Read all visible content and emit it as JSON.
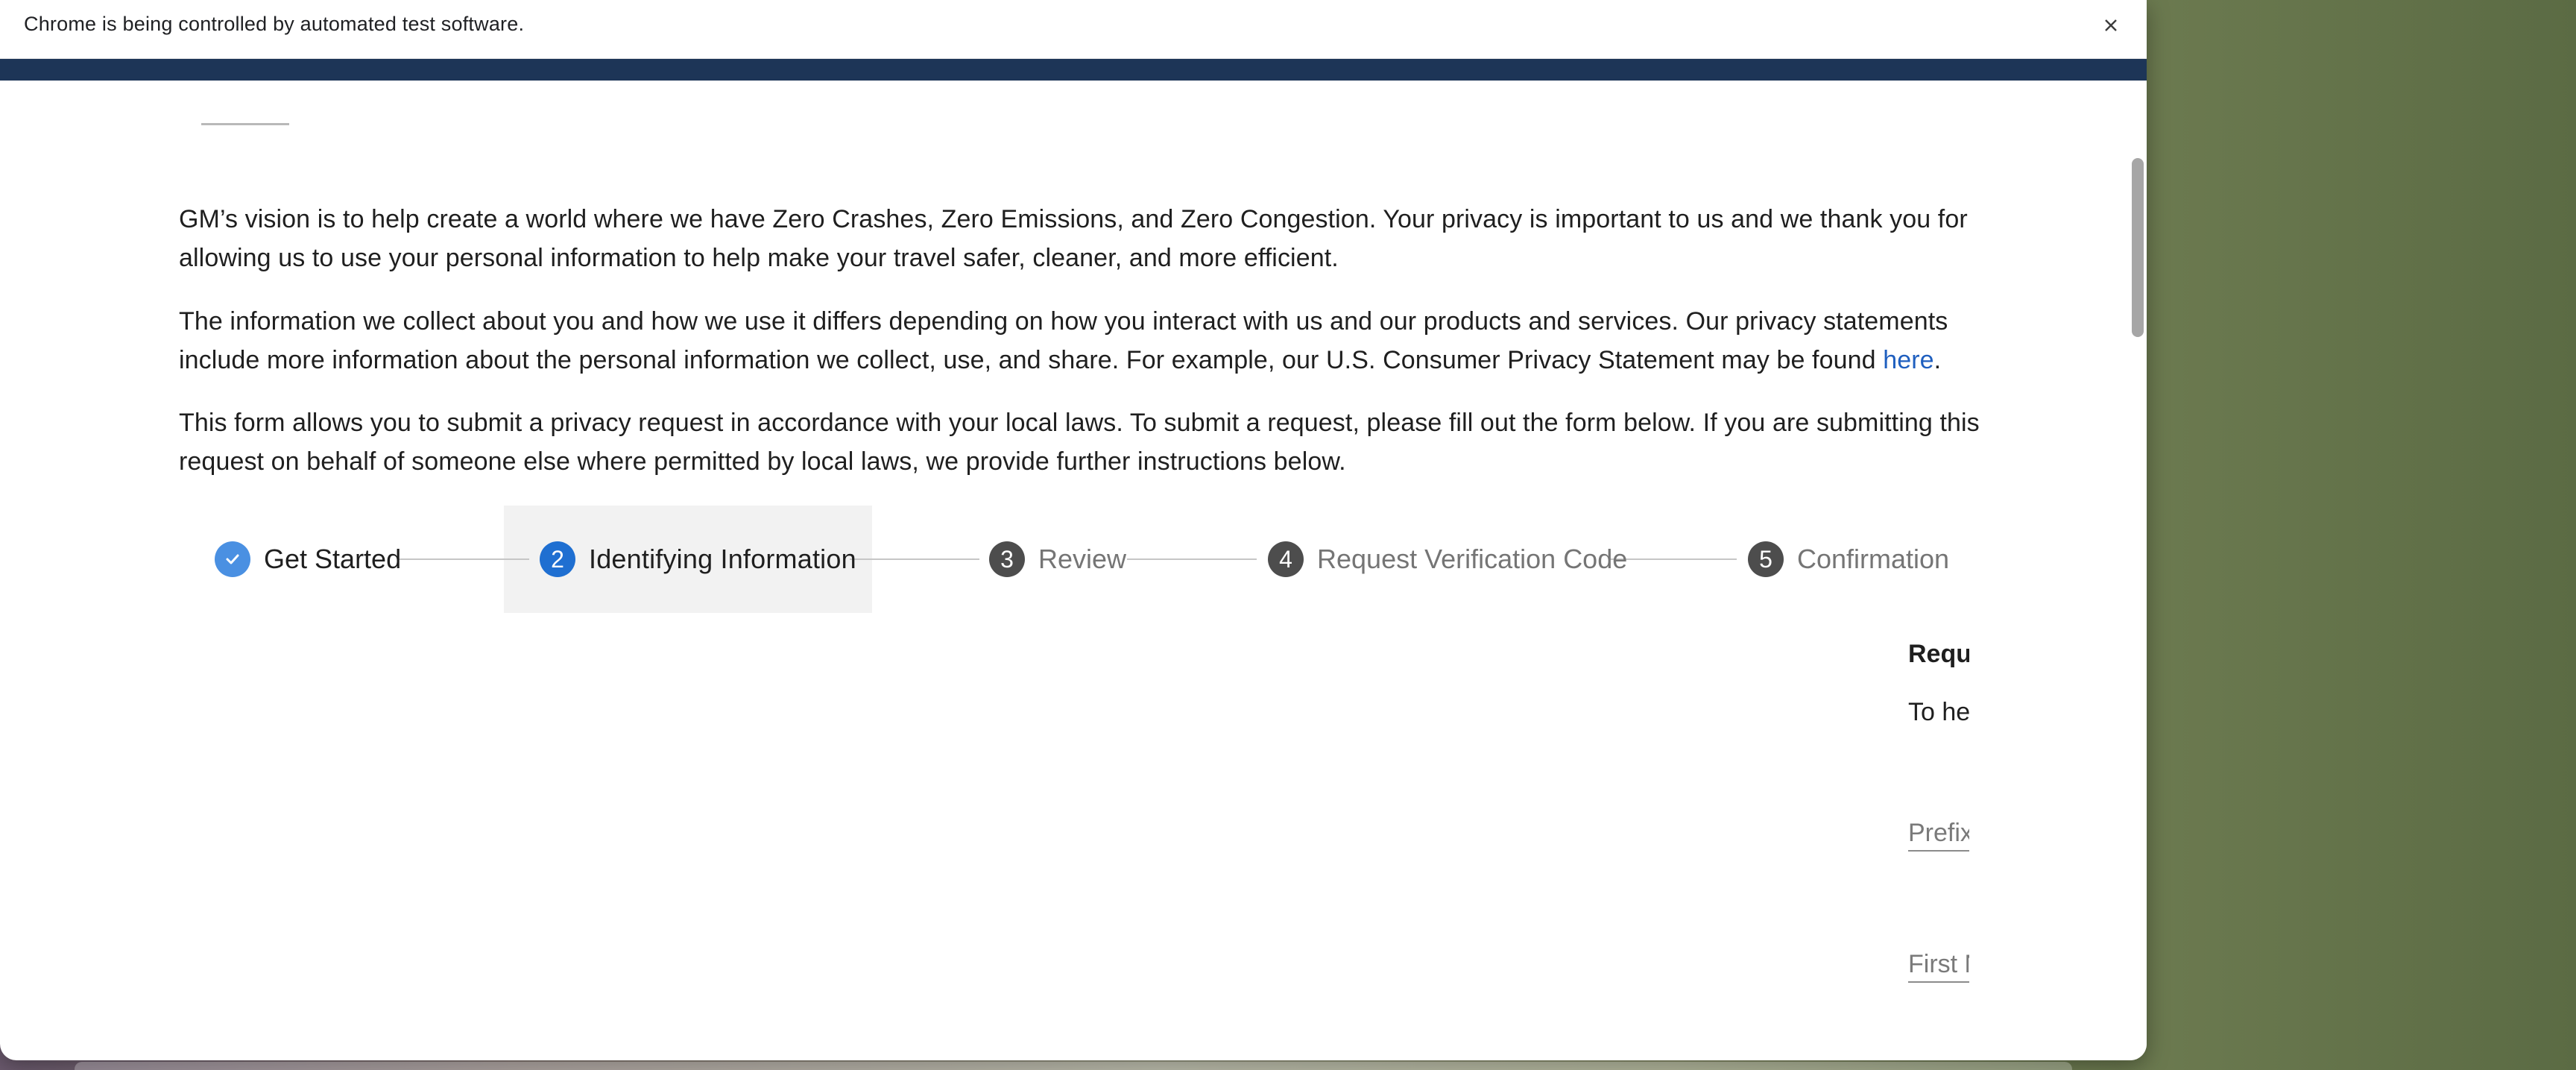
{
  "infobar": {
    "message": "Chrome is being controlled by automated test software.",
    "close_icon": "close-icon"
  },
  "intro": {
    "paragraph1": "GM’s vision is to help create a world where we have Zero Crashes, Zero Emissions, and Zero Congestion. Your privacy is important to us and we thank you for allowing us to use your personal information to help make your travel safer, cleaner, and more efficient.",
    "paragraph2_text": "The information we collect about you and how we use it differs depending on how you interact with us and our products and services. Our privacy statements include more information about the personal information we collect, use, and share. For example, our U.S. Consumer Privacy Statement may be found ",
    "paragraph2_link": "here",
    "paragraph2_end": ".",
    "paragraph3": "This form allows you to submit a privacy request in accordance with your local laws. To submit a request, please fill out the form below. If you are submitting this request on behalf of someone else where permitted by local laws, we provide further instructions below."
  },
  "stepper": {
    "steps": [
      {
        "number": "",
        "label": "Get Started",
        "state": "done",
        "icon": "check-icon"
      },
      {
        "number": "2",
        "label": "Identifying Information",
        "state": "active"
      },
      {
        "number": "3",
        "label": "Review",
        "state": "todo"
      },
      {
        "number": "4",
        "label": "Request Verification Code",
        "state": "todo"
      },
      {
        "number": "5",
        "label": "Confirmation",
        "state": "todo"
      }
    ]
  },
  "form": {
    "heading_partial": "Reque",
    "text_partial": "To hel",
    "prefix_placeholder": "Prefix",
    "first_name_placeholder": "First N"
  },
  "colors": {
    "navy_bar": "#1d3557",
    "link": "#1f5fbf",
    "step_done": "#4a90e2",
    "step_active": "#1f6fd1",
    "step_todo": "#4d4d4d"
  }
}
